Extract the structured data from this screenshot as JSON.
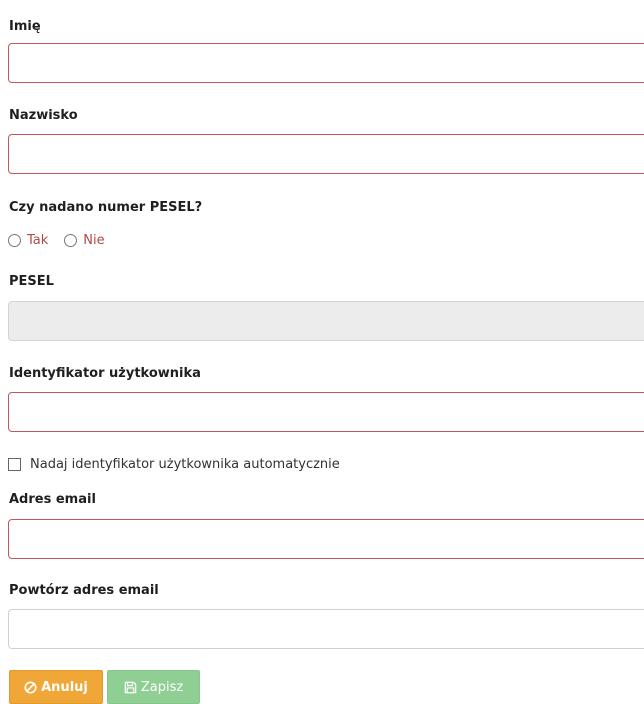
{
  "form": {
    "first_name": {
      "label": "Imię",
      "value": ""
    },
    "last_name": {
      "label": "Nazwisko",
      "value": ""
    },
    "pesel_question": {
      "label": "Czy nadano numer PESEL?",
      "options": [
        "Tak",
        "Nie"
      ],
      "selected": null
    },
    "pesel": {
      "label": "PESEL",
      "value": "",
      "disabled": true
    },
    "user_id": {
      "label": "Identyfikator użytkownika",
      "value": ""
    },
    "auto_id": {
      "label": "Nadaj identyfikator użytkownika automatycznie",
      "checked": false
    },
    "email": {
      "label": "Adres email",
      "value": ""
    },
    "email_repeat": {
      "label": "Powtórz adres email",
      "value": ""
    }
  },
  "actions": {
    "cancel_label": "Anuluj",
    "cancel_icon": "ban-icon",
    "save_label": "Zapisz",
    "save_icon": "floppy-disk-icon"
  },
  "colors": {
    "invalid_border": "#c0575d",
    "radio_text": "#b04a4a",
    "cancel_button": "#f0a737",
    "save_button": "#8fcf94",
    "disabled_field": "#ececec"
  }
}
